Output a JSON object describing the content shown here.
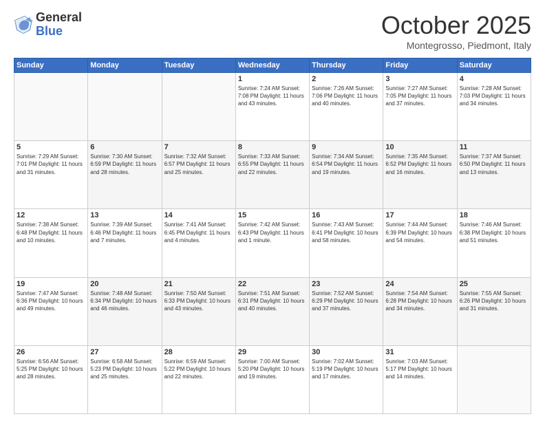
{
  "header": {
    "logo_general": "General",
    "logo_blue": "Blue",
    "month_title": "October 2025",
    "location": "Montegrosso, Piedmont, Italy"
  },
  "calendar": {
    "weekdays": [
      "Sunday",
      "Monday",
      "Tuesday",
      "Wednesday",
      "Thursday",
      "Friday",
      "Saturday"
    ],
    "weeks": [
      [
        {
          "day": "",
          "info": ""
        },
        {
          "day": "",
          "info": ""
        },
        {
          "day": "",
          "info": ""
        },
        {
          "day": "1",
          "info": "Sunrise: 7:24 AM\nSunset: 7:08 PM\nDaylight: 11 hours\nand 43 minutes."
        },
        {
          "day": "2",
          "info": "Sunrise: 7:26 AM\nSunset: 7:06 PM\nDaylight: 11 hours\nand 40 minutes."
        },
        {
          "day": "3",
          "info": "Sunrise: 7:27 AM\nSunset: 7:05 PM\nDaylight: 11 hours\nand 37 minutes."
        },
        {
          "day": "4",
          "info": "Sunrise: 7:28 AM\nSunset: 7:03 PM\nDaylight: 11 hours\nand 34 minutes."
        }
      ],
      [
        {
          "day": "5",
          "info": "Sunrise: 7:29 AM\nSunset: 7:01 PM\nDaylight: 11 hours\nand 31 minutes."
        },
        {
          "day": "6",
          "info": "Sunrise: 7:30 AM\nSunset: 6:59 PM\nDaylight: 11 hours\nand 28 minutes."
        },
        {
          "day": "7",
          "info": "Sunrise: 7:32 AM\nSunset: 6:57 PM\nDaylight: 11 hours\nand 25 minutes."
        },
        {
          "day": "8",
          "info": "Sunrise: 7:33 AM\nSunset: 6:55 PM\nDaylight: 11 hours\nand 22 minutes."
        },
        {
          "day": "9",
          "info": "Sunrise: 7:34 AM\nSunset: 6:54 PM\nDaylight: 11 hours\nand 19 minutes."
        },
        {
          "day": "10",
          "info": "Sunrise: 7:35 AM\nSunset: 6:52 PM\nDaylight: 11 hours\nand 16 minutes."
        },
        {
          "day": "11",
          "info": "Sunrise: 7:37 AM\nSunset: 6:50 PM\nDaylight: 11 hours\nand 13 minutes."
        }
      ],
      [
        {
          "day": "12",
          "info": "Sunrise: 7:38 AM\nSunset: 6:48 PM\nDaylight: 11 hours\nand 10 minutes."
        },
        {
          "day": "13",
          "info": "Sunrise: 7:39 AM\nSunset: 6:46 PM\nDaylight: 11 hours\nand 7 minutes."
        },
        {
          "day": "14",
          "info": "Sunrise: 7:41 AM\nSunset: 6:45 PM\nDaylight: 11 hours\nand 4 minutes."
        },
        {
          "day": "15",
          "info": "Sunrise: 7:42 AM\nSunset: 6:43 PM\nDaylight: 11 hours\nand 1 minute."
        },
        {
          "day": "16",
          "info": "Sunrise: 7:43 AM\nSunset: 6:41 PM\nDaylight: 10 hours\nand 58 minutes."
        },
        {
          "day": "17",
          "info": "Sunrise: 7:44 AM\nSunset: 6:39 PM\nDaylight: 10 hours\nand 54 minutes."
        },
        {
          "day": "18",
          "info": "Sunrise: 7:46 AM\nSunset: 6:38 PM\nDaylight: 10 hours\nand 51 minutes."
        }
      ],
      [
        {
          "day": "19",
          "info": "Sunrise: 7:47 AM\nSunset: 6:36 PM\nDaylight: 10 hours\nand 49 minutes."
        },
        {
          "day": "20",
          "info": "Sunrise: 7:48 AM\nSunset: 6:34 PM\nDaylight: 10 hours\nand 46 minutes."
        },
        {
          "day": "21",
          "info": "Sunrise: 7:50 AM\nSunset: 6:33 PM\nDaylight: 10 hours\nand 43 minutes."
        },
        {
          "day": "22",
          "info": "Sunrise: 7:51 AM\nSunset: 6:31 PM\nDaylight: 10 hours\nand 40 minutes."
        },
        {
          "day": "23",
          "info": "Sunrise: 7:52 AM\nSunset: 6:29 PM\nDaylight: 10 hours\nand 37 minutes."
        },
        {
          "day": "24",
          "info": "Sunrise: 7:54 AM\nSunset: 6:28 PM\nDaylight: 10 hours\nand 34 minutes."
        },
        {
          "day": "25",
          "info": "Sunrise: 7:55 AM\nSunset: 6:26 PM\nDaylight: 10 hours\nand 31 minutes."
        }
      ],
      [
        {
          "day": "26",
          "info": "Sunrise: 6:56 AM\nSunset: 5:25 PM\nDaylight: 10 hours\nand 28 minutes."
        },
        {
          "day": "27",
          "info": "Sunrise: 6:58 AM\nSunset: 5:23 PM\nDaylight: 10 hours\nand 25 minutes."
        },
        {
          "day": "28",
          "info": "Sunrise: 6:59 AM\nSunset: 5:22 PM\nDaylight: 10 hours\nand 22 minutes."
        },
        {
          "day": "29",
          "info": "Sunrise: 7:00 AM\nSunset: 5:20 PM\nDaylight: 10 hours\nand 19 minutes."
        },
        {
          "day": "30",
          "info": "Sunrise: 7:02 AM\nSunset: 5:19 PM\nDaylight: 10 hours\nand 17 minutes."
        },
        {
          "day": "31",
          "info": "Sunrise: 7:03 AM\nSunset: 5:17 PM\nDaylight: 10 hours\nand 14 minutes."
        },
        {
          "day": "",
          "info": ""
        }
      ]
    ]
  }
}
